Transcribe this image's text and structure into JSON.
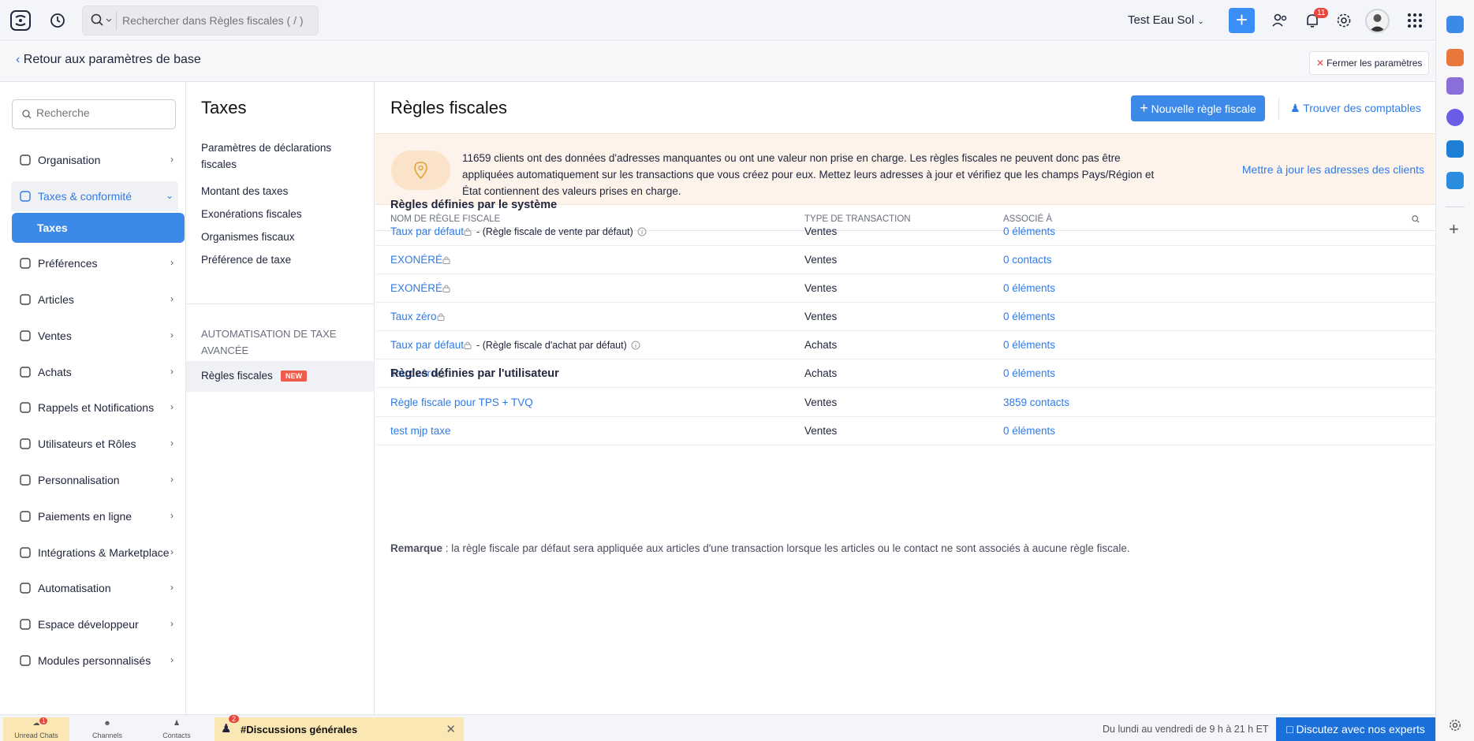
{
  "topbar": {
    "search_placeholder": "Rechercher dans Règles fiscales ( / )",
    "org_name": "Test Eau Sol",
    "notifications_count": "11"
  },
  "subheader": {
    "back_label": "Retour aux paramètres de base",
    "close_label": "Fermer les paramètres"
  },
  "sidebar": {
    "search_placeholder": "Recherche",
    "items": [
      {
        "label": "Organisation",
        "icon": "building-icon"
      },
      {
        "label": "Taxes & conformité",
        "icon": "tax-icon"
      },
      {
        "label": "Préférences",
        "icon": "preferences-icon"
      },
      {
        "label": "Articles",
        "icon": "bag-icon"
      },
      {
        "label": "Ventes",
        "icon": "cart-icon"
      },
      {
        "label": "Achats",
        "icon": "purchase-icon"
      },
      {
        "label": "Rappels et Notifications",
        "icon": "bell-icon"
      },
      {
        "label": "Utilisateurs et Rôles",
        "icon": "users-icon"
      },
      {
        "label": "Personnalisation",
        "icon": "brush-icon"
      },
      {
        "label": "Paiements en ligne",
        "icon": "card-icon"
      },
      {
        "label": "Intégrations & Marketplace",
        "icon": "integration-icon"
      },
      {
        "label": "Automatisation",
        "icon": "automation-icon"
      },
      {
        "label": "Espace développeur",
        "icon": "developer-icon"
      },
      {
        "label": "Modules personnalisés",
        "icon": "module-icon"
      }
    ],
    "active_sub": "Taxes"
  },
  "midpanel": {
    "title": "Taxes",
    "links": [
      "Paramètres de déclarations fiscales",
      "Montant des taxes",
      "Exonérations fiscales",
      "Organismes fiscaux",
      "Préférence de taxe"
    ],
    "group_title": "AUTOMATISATION DE TAXE AVANCÉE",
    "active_link": "Règles fiscales",
    "new_badge": "NEW"
  },
  "main": {
    "title": "Règles fiscales",
    "new_button": "Nouvelle règle fiscale",
    "find_accountants": "Trouver des comptables",
    "banner": {
      "message": "11659 clients ont des données d'adresses manquantes ou ont une valeur non prise en charge. Les règles fiscales ne peuvent donc pas être appliquées automatiquement sur les transactions que vous créez pour eux. Mettez leurs adresses à jour et vérifiez que les champs Pays/Région et État contiennent des valeurs prises en charge.",
      "action": "Mettre à jour les adresses des clients"
    },
    "columns": [
      "NOM DE RÈGLE FISCALE",
      "TYPE DE TRANSACTION",
      "ASSOCIÉ À"
    ],
    "system_group": "Règles définies par le système",
    "system_rows": [
      {
        "name": "Taux par défaut",
        "note": "- (Règle fiscale de vente par défaut)",
        "type": "Ventes",
        "assoc": "0 éléments"
      },
      {
        "name": "EXONÉRÉ",
        "note": "",
        "type": "Ventes",
        "assoc": "0 contacts"
      },
      {
        "name": "EXONÉRÉ",
        "note": "",
        "type": "Ventes",
        "assoc": "0 éléments"
      },
      {
        "name": "Taux zéro",
        "note": "",
        "type": "Ventes",
        "assoc": "0 éléments"
      },
      {
        "name": "Taux par défaut",
        "note": "- (Règle fiscale d'achat par défaut)",
        "type": "Achats",
        "assoc": "0 éléments"
      },
      {
        "name": "Taux zéro",
        "note": "",
        "type": "Achats",
        "assoc": "0 éléments"
      }
    ],
    "user_group": "Règles définies par l'utilisateur",
    "user_rows": [
      {
        "name": "Règle fiscale pour TPS + TVQ",
        "type": "Ventes",
        "assoc": "3859 contacts"
      },
      {
        "name": "test mjp taxe",
        "type": "Ventes",
        "assoc": "0 éléments"
      }
    ],
    "remark_label": "Remarque",
    "remark_text": " : la règle fiscale par défaut sera appliquée aux articles d'une transaction lorsque les articles ou le contact ne sont associés à aucune règle fiscale."
  },
  "bottombar": {
    "unread": "Unread Chats",
    "unread_count": "1",
    "channels": "Channels",
    "contacts": "Contacts",
    "discussion": "#Discussions générales",
    "discussion_count": "2",
    "hours": "Du lundi au vendredi de 9 h à 21 h ET",
    "expert": "Discutez avec nos experts"
  }
}
